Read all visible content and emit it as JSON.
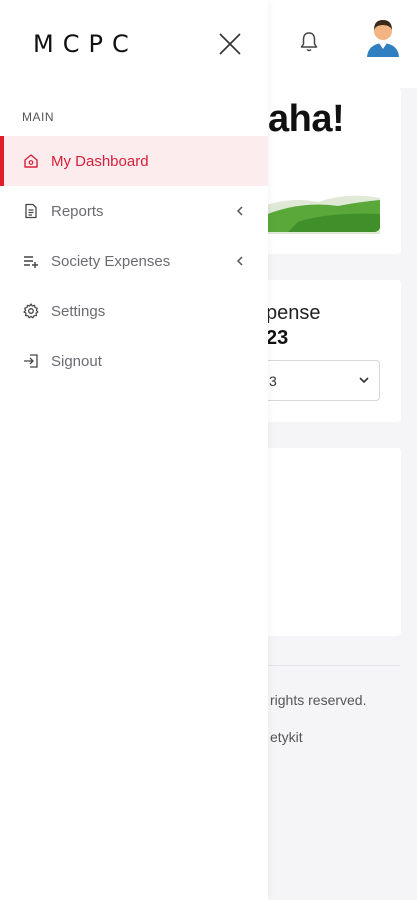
{
  "app": {
    "brand": "MCPC"
  },
  "sidebar": {
    "section_label": "MAIN",
    "items": [
      {
        "label": "My Dashboard",
        "icon": "home-icon",
        "active": true
      },
      {
        "label": "Reports",
        "icon": "document-icon",
        "has_submenu": true
      },
      {
        "label": "Society Expenses",
        "icon": "add-list-icon",
        "has_submenu": true
      },
      {
        "label": "Settings",
        "icon": "gear-icon"
      },
      {
        "label": "Signout",
        "icon": "signout-icon"
      }
    ]
  },
  "header": {
    "notification_icon": "bell-icon",
    "avatar_icon": "user-avatar-icon"
  },
  "welcome": {
    "title_fragment": "aha!"
  },
  "expense": {
    "label_fragment": "pense",
    "year_fragment": "23",
    "select_value_fragment": "3"
  },
  "footer": {
    "copyright_fragment": "rights reserved.",
    "credit_fragment": "etykit"
  },
  "colors": {
    "accent": "#e11d2a",
    "active_text": "#d6203a",
    "active_bg": "#fdecee"
  }
}
